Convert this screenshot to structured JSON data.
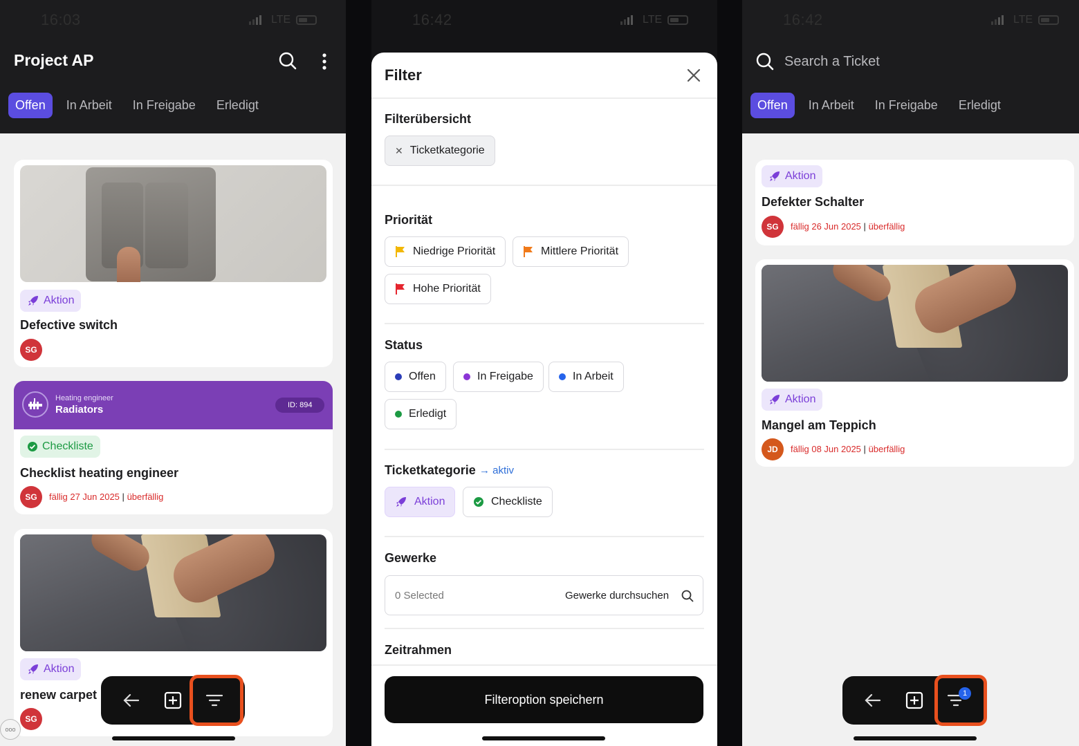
{
  "screen1": {
    "status": {
      "time": "16:03",
      "network": "LTE"
    },
    "title": "Project AP",
    "tabs": [
      {
        "label": "Offen"
      },
      {
        "label": "In Arbeit"
      },
      {
        "label": "In Freigabe"
      },
      {
        "label": "Erledigt"
      }
    ],
    "cards": [
      {
        "badge": "Aktion",
        "title": "Defective switch",
        "avatar": "SG"
      },
      {
        "header_role": "Heating engineer",
        "header_title": "Radiators",
        "header_id": "ID: 894",
        "badge": "Checkliste",
        "title": "Checklist heating engineer",
        "avatar": "SG",
        "due": "fällig 27 Jun 2025",
        "overdue": "überfällig"
      },
      {
        "badge": "Aktion",
        "title": "renew carpet",
        "avatar": "SG"
      }
    ]
  },
  "screen2": {
    "status": {
      "time": "16:42",
      "network": "LTE"
    },
    "sheet_title": "Filter",
    "overview": {
      "label": "Filterübersicht",
      "chip": "Ticketkategorie"
    },
    "priority": {
      "label": "Priorität",
      "options": [
        "Niedrige Priorität",
        "Mittlere Priorität",
        "Hohe Priorität"
      ]
    },
    "status_filter": {
      "label": "Status",
      "options": [
        "Offen",
        "In Freigabe",
        "In Arbeit",
        "Erledigt"
      ]
    },
    "category": {
      "label": "Ticketkategorie",
      "active": "→ aktiv",
      "options": [
        "Aktion",
        "Checkliste"
      ]
    },
    "trades": {
      "label": "Gewerke",
      "selected": "0 Selected",
      "search": "Gewerke durchsuchen"
    },
    "timeframe": {
      "label": "Zeitrahmen"
    },
    "save_button": "Filteroption speichern"
  },
  "screen3": {
    "status": {
      "time": "16:42",
      "network": "LTE"
    },
    "search_placeholder": "Search a Ticket",
    "tabs": [
      {
        "label": "Offen"
      },
      {
        "label": "In Arbeit"
      },
      {
        "label": "In Freigabe"
      },
      {
        "label": "Erledigt"
      }
    ],
    "cards": [
      {
        "badge": "Aktion",
        "title": "Defekter Schalter",
        "avatar": "SG",
        "due": "fällig 26 Jun 2025",
        "overdue": "überfällig"
      },
      {
        "badge": "Aktion",
        "title": "Mangel am Teppich",
        "avatar": "JD",
        "due": "fällig 08 Jun 2025",
        "overdue": "überfällig"
      }
    ],
    "filter_count": "1"
  },
  "colors": {
    "accent": "#5b4de0",
    "aktion": "#7b3fd8",
    "checklist": "#1c9a43",
    "overdue": "#d92b2b",
    "highlight": "#e8501e",
    "header_purple": "#7b3fb5"
  }
}
